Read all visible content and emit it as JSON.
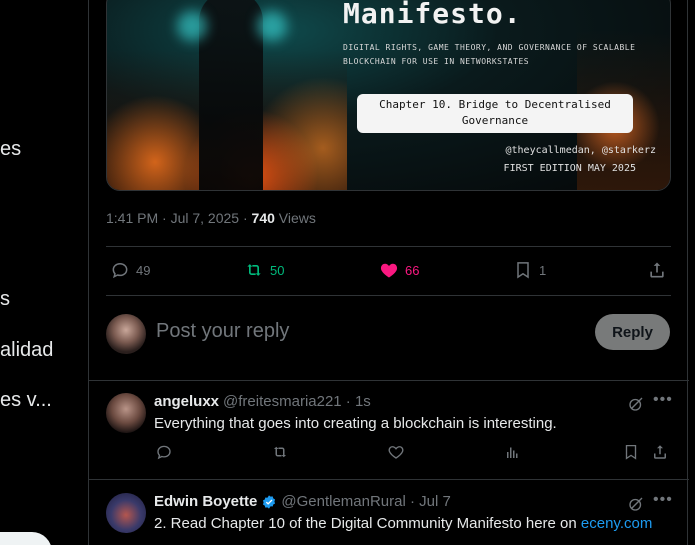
{
  "left_nav": {
    "fragments": [
      "es",
      "s",
      "alidad",
      "es v..."
    ]
  },
  "media": {
    "title": "Manifesto.",
    "subtitle": "DIGITAL RIGHTS, GAME THEORY, AND GOVERNANCE OF SCALABLE BLOCKCHAIN FOR USE IN NETWORKSTATES",
    "chapter_line1": "Chapter 10. Bridge to Decentralised",
    "chapter_line2": "Governance",
    "handles": "@theycallmedan, @starkerz",
    "edition": "FIRST EDITION MAY 2025"
  },
  "meta": {
    "time": "1:41 PM · Jul 7, 2025 · ",
    "views_count": "740",
    "views_label": " Views"
  },
  "actions": {
    "replies": "49",
    "reposts": "50",
    "likes": "66",
    "bookmarks": "1"
  },
  "composer": {
    "placeholder": "Post your reply",
    "reply_label": "Reply"
  },
  "replies": [
    {
      "name": "angeluxx",
      "handle": "@freitesmaria221 · 1s",
      "text": "Everything that goes into creating a blockchain is interesting."
    },
    {
      "name": "Edwin Boyette",
      "handle": "@GentlemanRural · Jul 7",
      "text": "2.  Read Chapter 10 of the Digital Community Manifesto here on ",
      "link": "eceny.com"
    }
  ],
  "colors": {
    "repost": "#00ba7c",
    "like": "#f91880",
    "link": "#1d9bf0",
    "muted": "#71767b"
  }
}
